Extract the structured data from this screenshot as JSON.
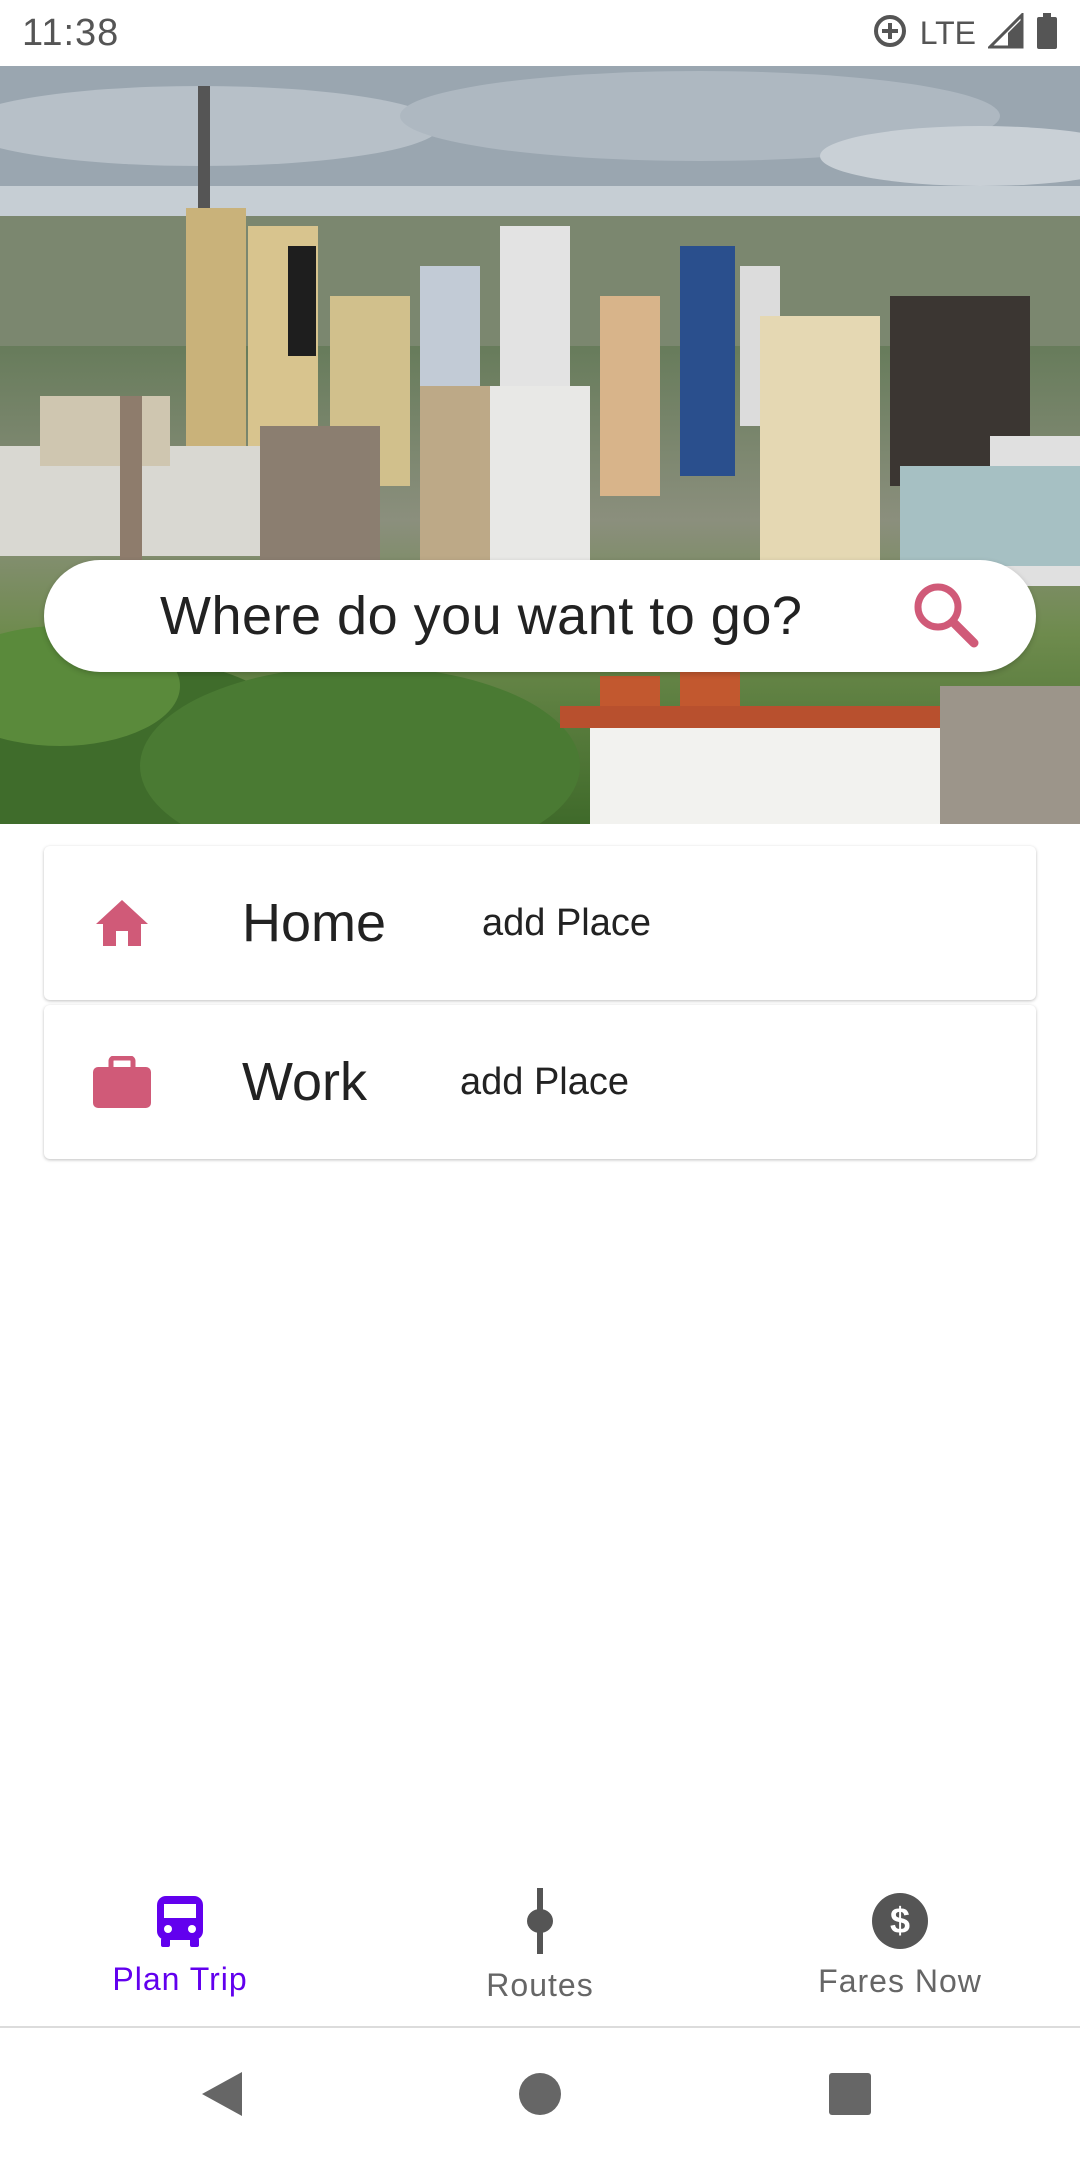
{
  "status_bar": {
    "time": "11:38",
    "network": "LTE",
    "icons": [
      "data-saver-icon",
      "signal-icon",
      "battery-icon"
    ]
  },
  "hero": {
    "image": "city-skyline-photo"
  },
  "search": {
    "placeholder": "Where do you want to go?",
    "icon": "search-icon"
  },
  "places": [
    {
      "title": "Home",
      "action": "add Place",
      "icon": "home-icon"
    },
    {
      "title": "Work",
      "action": "add Place",
      "icon": "briefcase-icon"
    }
  ],
  "bottom_nav": {
    "items": [
      {
        "label": "Plan Trip",
        "icon": "bus-icon",
        "active": true
      },
      {
        "label": "Routes",
        "icon": "route-icon",
        "active": false
      },
      {
        "label": "Fares Now",
        "icon": "dollar-icon",
        "active": false
      }
    ]
  },
  "colors": {
    "accent": "#6200ee",
    "icon_pink": "#d05a78",
    "inactive": "#555555"
  }
}
